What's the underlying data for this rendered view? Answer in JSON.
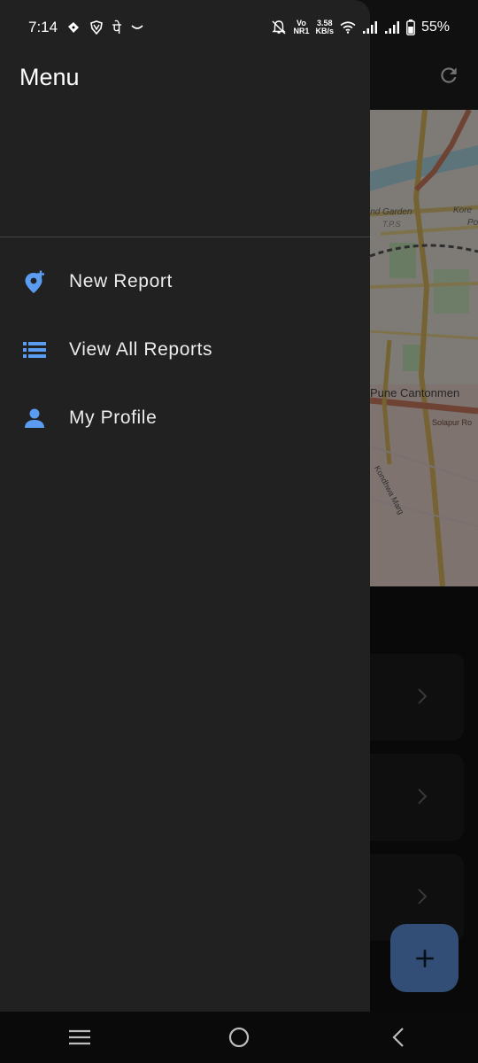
{
  "status_bar": {
    "time": "7:14",
    "devanagari": "पे",
    "vo": "Vo",
    "nr": "NR1",
    "speed": "3.58",
    "speed_unit": "KB/s",
    "battery": "55%"
  },
  "drawer": {
    "title": "Menu",
    "items": [
      {
        "label": "New Report",
        "icon": "add-location-icon"
      },
      {
        "label": "View All Reports",
        "icon": "list-icon"
      },
      {
        "label": "My Profile",
        "icon": "person-icon"
      }
    ]
  },
  "map": {
    "labels": {
      "cantonment": "Pune Cantonmen",
      "solapur": "Solapur Ro",
      "garden": "ind Garden",
      "tps": "T.P.S",
      "kore": "Kore",
      "po": "Po",
      "kondhwa": "Kondhwa Marg"
    }
  },
  "colors": {
    "accent": "#5b8fd8",
    "drawer_bg": "#212121",
    "icon_blue": "#5b9cf0"
  }
}
